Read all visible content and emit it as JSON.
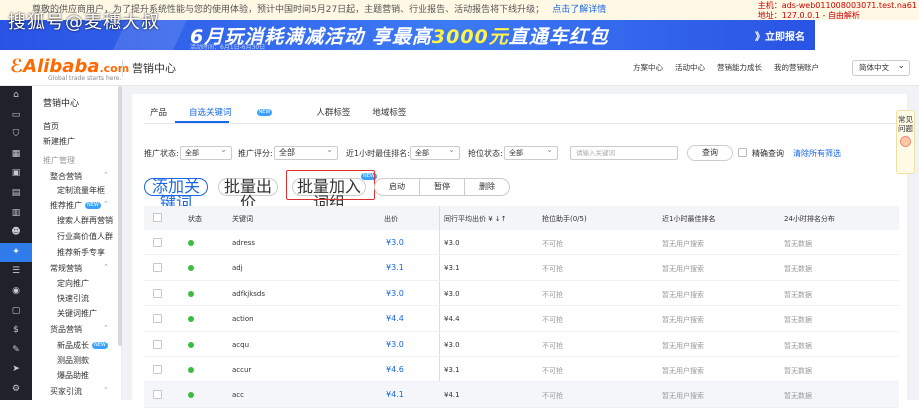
{
  "notice": {
    "text": "尊敬的供应商用户，为了提升系统性能与您的使用体验，预计中国时间5月27日起，主题营销、行业报告、活动报告将下线升级；",
    "link": "点击了解详情"
  },
  "debug": {
    "line1": "主机：ads-web011008003071.test.na61",
    "line2": "地址：127.0.0.1 - 自由解析"
  },
  "watermark": "搜狐号@麦穗大叔",
  "banner": {
    "main_prefix": "6月玩消耗满减活动",
    "main_mid": "享最高",
    "main_hl": "3000元",
    "main_suffix": "直通车红包",
    "sub": "活动时间：6月1日-6月30日",
    "cta": "》立即报名",
    "bg_color": "#2a53e4"
  },
  "topbar": {
    "logo": "Alibaba",
    "logo_com": ".com",
    "logo_sub": "Global trade starts here.",
    "product": "营销中心",
    "nav": [
      "方案中心",
      "活动中心",
      "营销能力成长",
      "我的营销账户"
    ],
    "language": "简体中文"
  },
  "iconbar": [
    "home-icon",
    "doc-icon",
    "shield-icon",
    "grid-icon",
    "store-icon",
    "chat-icon",
    "chart-icon",
    "users-icon",
    "rocket-icon",
    "list-icon",
    "globe-icon",
    "bag-icon",
    "dollar-icon",
    "tool-icon",
    "send-icon",
    "gear-icon"
  ],
  "sidebar": {
    "title": "营销中心",
    "items": [
      {
        "label": "首页",
        "kind": "link"
      },
      {
        "label": "新建推广",
        "kind": "link"
      },
      {
        "label": "推广管理",
        "kind": "group"
      },
      {
        "label": "整合营销",
        "kind": "section"
      },
      {
        "label": "定制流量年框",
        "kind": "sub"
      },
      {
        "label": "推荐推广",
        "kind": "section",
        "badge": "NEW"
      },
      {
        "label": "搜索人群再营销",
        "kind": "sub"
      },
      {
        "label": "行业高价值人群",
        "kind": "sub"
      },
      {
        "label": "推荐新手专享",
        "kind": "sub"
      },
      {
        "label": "常规营销",
        "kind": "section"
      },
      {
        "label": "定向推广",
        "kind": "sub"
      },
      {
        "label": "快速引流",
        "kind": "sub"
      },
      {
        "label": "关键词推广",
        "kind": "sub"
      },
      {
        "label": "货品营销",
        "kind": "section"
      },
      {
        "label": "新品成长",
        "kind": "sub",
        "badge": "NEW"
      },
      {
        "label": "测品测款",
        "kind": "sub"
      },
      {
        "label": "爆品助推",
        "kind": "sub"
      },
      {
        "label": "买家引流",
        "kind": "section"
      }
    ]
  },
  "tabs": [
    {
      "label": "产品",
      "active": false
    },
    {
      "label": "自选关键词",
      "active": true,
      "badge": "NEW"
    },
    {
      "label": "人群标签",
      "active": false
    },
    {
      "label": "地域标签",
      "active": false
    }
  ],
  "filters": {
    "status_label": "推广状态:",
    "status_value": "全部",
    "score_label": "推广评分:",
    "score_value": "全部",
    "rank_label": "近1小时最佳排名:",
    "rank_value": "全部",
    "bid_label": "抢位状态:",
    "bid_value": "全部",
    "keyword_placeholder": "请输入关键词",
    "query_button": "查询",
    "exact_label": "精确查询",
    "clear_label": "清除所有筛选"
  },
  "actions": {
    "add_keyword": "添加关键词",
    "batch_bid": "批量出价",
    "batch_group": "批量加入词组",
    "batch_group_badge": "NEW",
    "start": "启动",
    "pause": "暂停",
    "delete": "删除"
  },
  "table": {
    "headers": [
      "状态",
      "关键词",
      "出价",
      "同行平均出价 ¥ ↓↑",
      "抢位助手(0/5)",
      "近1小时最佳排名",
      "24小时排名分布"
    ],
    "rows": [
      {
        "keyword": "adress",
        "bid": "¥3.0",
        "avg": "¥3.0",
        "assist": "不可抢",
        "rank": "暂无用户搜索",
        "dist": "暂无数据"
      },
      {
        "keyword": "adj",
        "bid": "¥3.1",
        "avg": "¥3.1",
        "assist": "不可抢",
        "rank": "暂无用户搜索",
        "dist": "暂无数据"
      },
      {
        "keyword": "adfkjksds",
        "bid": "¥3.0",
        "avg": "¥3.0",
        "assist": "不可抢",
        "rank": "暂无用户搜索",
        "dist": "暂无数据"
      },
      {
        "keyword": "action",
        "bid": "¥4.4",
        "avg": "¥4.4",
        "assist": "不可抢",
        "rank": "暂无用户搜索",
        "dist": "暂无数据"
      },
      {
        "keyword": "acqu",
        "bid": "¥3.0",
        "avg": "¥3.0",
        "assist": "不可抢",
        "rank": "暂无用户搜索",
        "dist": "暂无数据"
      },
      {
        "keyword": "accur",
        "bid": "¥4.6",
        "avg": "¥3.1",
        "assist": "不可抢",
        "rank": "暂无用户搜索",
        "dist": "暂无数据"
      },
      {
        "keyword": "acc",
        "bid": "¥4.1",
        "avg": "¥4.1",
        "assist": "不可抢",
        "rank": "暂无用户搜索",
        "dist": "暂无数据"
      }
    ]
  },
  "help": {
    "label": "常见问题"
  },
  "colors": {
    "accent": "#1767e6",
    "brand": "#ff6a00",
    "status_on": "#3cbc43",
    "highlight": "#e02e2e"
  }
}
